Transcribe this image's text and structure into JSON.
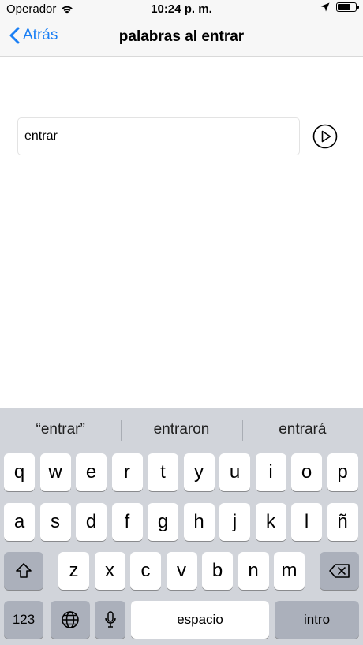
{
  "status_bar": {
    "carrier": "Operador",
    "time": "10:24 p. m.",
    "battery_level": 0.8
  },
  "nav": {
    "back_label": "Atrás",
    "title": "palabras al entrar"
  },
  "main": {
    "input_value": "entrar"
  },
  "keyboard": {
    "predictions": [
      "“entrar”",
      "entraron",
      "entrará"
    ],
    "row1": [
      "q",
      "w",
      "e",
      "r",
      "t",
      "y",
      "u",
      "i",
      "o",
      "p"
    ],
    "row2": [
      "a",
      "s",
      "d",
      "f",
      "g",
      "h",
      "j",
      "k",
      "l",
      "ñ"
    ],
    "row3": [
      "z",
      "x",
      "c",
      "v",
      "b",
      "n",
      "m"
    ],
    "numbers_label": "123",
    "space_label": "espacio",
    "return_label": "intro"
  },
  "colors": {
    "accent": "#1a7ff5",
    "keyboard_bg": "#d1d4da",
    "special_key": "#abb0bb"
  }
}
